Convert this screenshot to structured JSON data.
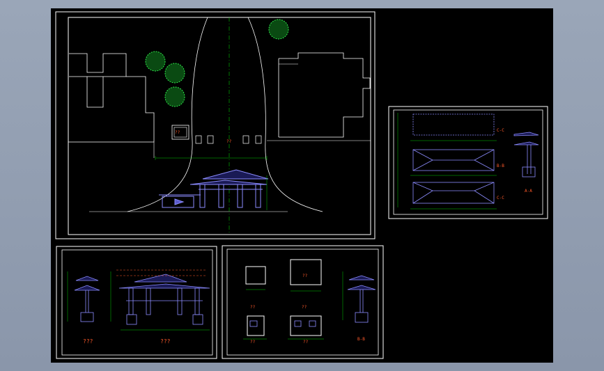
{
  "sheets": {
    "site_plan": {
      "label": "??"
    },
    "plans": {
      "labels": [
        "C-C",
        "B-B",
        "C-C"
      ],
      "section_label": "A-A"
    },
    "elevations": {
      "labels": [
        "???",
        "???"
      ]
    },
    "guardhouse": {
      "labels": [
        "??",
        "??",
        "??",
        "??",
        "B-B"
      ],
      "room_label": "??"
    }
  },
  "colors": {
    "background": "#000000",
    "frame": "#ffffff",
    "structure": "#8c8cff",
    "dimension": "#00c800",
    "tree": "#2ee84a",
    "centerline": "#00c800",
    "text": "#ff5a2a",
    "outer": "#9aa6b8"
  }
}
